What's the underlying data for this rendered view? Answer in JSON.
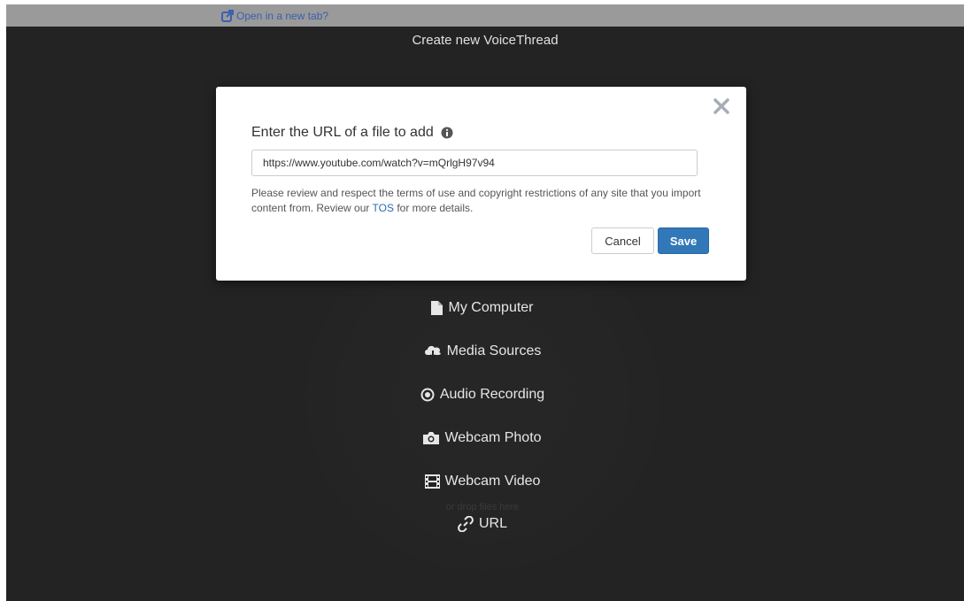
{
  "top_bar": {
    "open_tab_label": "Open in a new tab?",
    "link_color": "#3a60b0"
  },
  "page": {
    "title": "Create new VoiceThread"
  },
  "upload_menu": {
    "items": [
      {
        "label": "My Computer",
        "icon": "file-icon"
      },
      {
        "label": "Media Sources",
        "icon": "cloud-download-icon"
      },
      {
        "label": "Audio Recording",
        "icon": "record-icon"
      },
      {
        "label": "Webcam Photo",
        "icon": "camera-icon"
      },
      {
        "label": "Webcam Video",
        "icon": "film-icon"
      },
      {
        "label": "URL",
        "icon": "link-icon"
      }
    ],
    "drop_hint": "or drop files here"
  },
  "modal": {
    "heading": "Enter the URL of a file to add",
    "info_icon": "info-icon",
    "close_icon": "close-icon",
    "url_value": "https://www.youtube.com/watch?v=mQrlgH97v94",
    "notice_text": "Please review and respect the terms of use and copyright restrictions of any site that you import content from. Review our",
    "tos_label": "TOS",
    "notice_suffix": "for more details.",
    "cancel_label": "Cancel",
    "save_label": "Save",
    "accent_color": "#3277b8"
  }
}
